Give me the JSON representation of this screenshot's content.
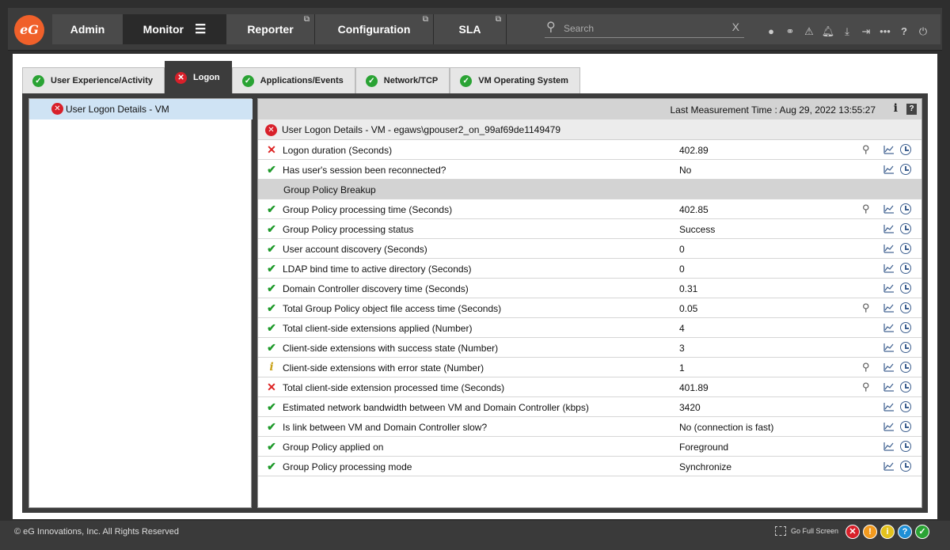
{
  "nav": {
    "logo": "eG",
    "tabs": [
      {
        "label": "Admin"
      },
      {
        "label": "Monitor"
      },
      {
        "label": "Reporter"
      },
      {
        "label": "Configuration"
      },
      {
        "label": "SLA"
      }
    ],
    "search_placeholder": "Search",
    "search_clear": "X",
    "icons": [
      "user-icon",
      "link-icon",
      "warning-icon",
      "bell-icon",
      "download-icon",
      "login-icon",
      "more-icon",
      "help-icon",
      "power-icon"
    ]
  },
  "content_tabs": [
    {
      "label": "User Experience/Activity",
      "status": "ok"
    },
    {
      "label": "Logon",
      "status": "error"
    },
    {
      "label": "Applications/Events",
      "status": "ok"
    },
    {
      "label": "Network/TCP",
      "status": "ok"
    },
    {
      "label": "VM Operating System",
      "status": "ok"
    }
  ],
  "tree": {
    "item": "User Logon Details - VM"
  },
  "measurement": {
    "text": "Last Measurement Time : Aug 29, 2022 13:55:27",
    "info": "i",
    "help": "?"
  },
  "detail_header": "User Logon Details - VM - egaws\\gpouser2_on_99af69de1149479",
  "rows": [
    {
      "label": "Logon duration (Seconds)",
      "value": "402.89",
      "status": "error",
      "zoom": true
    },
    {
      "label": "Has user's session been reconnected?",
      "value": "No",
      "status": "ok",
      "zoom": false
    },
    {
      "label": "Group Policy Breakup",
      "value": "",
      "status": "section",
      "zoom": false
    },
    {
      "label": "Group Policy processing time (Seconds)",
      "value": "402.85",
      "status": "ok",
      "zoom": true
    },
    {
      "label": "Group Policy processing status",
      "value": "Success",
      "status": "ok",
      "zoom": false
    },
    {
      "label": "User account discovery (Seconds)",
      "value": "0",
      "status": "ok",
      "zoom": false
    },
    {
      "label": "LDAP bind time to active directory (Seconds)",
      "value": "0",
      "status": "ok",
      "zoom": false
    },
    {
      "label": "Domain Controller discovery time (Seconds)",
      "value": "0.31",
      "status": "ok",
      "zoom": false
    },
    {
      "label": "Total Group Policy object file access time (Seconds)",
      "value": "0.05",
      "status": "ok",
      "zoom": true
    },
    {
      "label": "Total client-side extensions applied (Number)",
      "value": "4",
      "status": "ok",
      "zoom": false
    },
    {
      "label": "Client-side extensions with success state (Number)",
      "value": "3",
      "status": "ok",
      "zoom": false
    },
    {
      "label": "Client-side extensions with error state (Number)",
      "value": "1",
      "status": "info",
      "zoom": true
    },
    {
      "label": "Total client-side extension processed time (Seconds)",
      "value": "401.89",
      "status": "error",
      "zoom": true
    },
    {
      "label": "Estimated network bandwidth between VM and Domain Controller (kbps)",
      "value": "3420",
      "status": "ok",
      "zoom": false
    },
    {
      "label": "Is link between VM and Domain Controller slow?",
      "value": "No (connection is fast)",
      "status": "ok",
      "zoom": false
    },
    {
      "label": "Group Policy applied on",
      "value": "Foreground",
      "status": "ok",
      "zoom": false
    },
    {
      "label": "Group Policy processing mode",
      "value": "Synchronize",
      "status": "ok",
      "zoom": false
    }
  ],
  "footer": {
    "copyright": "© eG Innovations, Inc. All Rights Reserved",
    "fullscreen": "Go Full Screen",
    "status_icons": [
      {
        "name": "critical-icon",
        "glyph": "✕",
        "color": "#d8202a"
      },
      {
        "name": "major-icon",
        "glyph": "!",
        "color": "#f29a1f"
      },
      {
        "name": "minor-icon",
        "glyph": "i",
        "color": "#e3c21c"
      },
      {
        "name": "unknown-icon",
        "glyph": "?",
        "color": "#1e8fd6"
      },
      {
        "name": "normal-icon",
        "glyph": "✓",
        "color": "#2aa334"
      }
    ]
  }
}
